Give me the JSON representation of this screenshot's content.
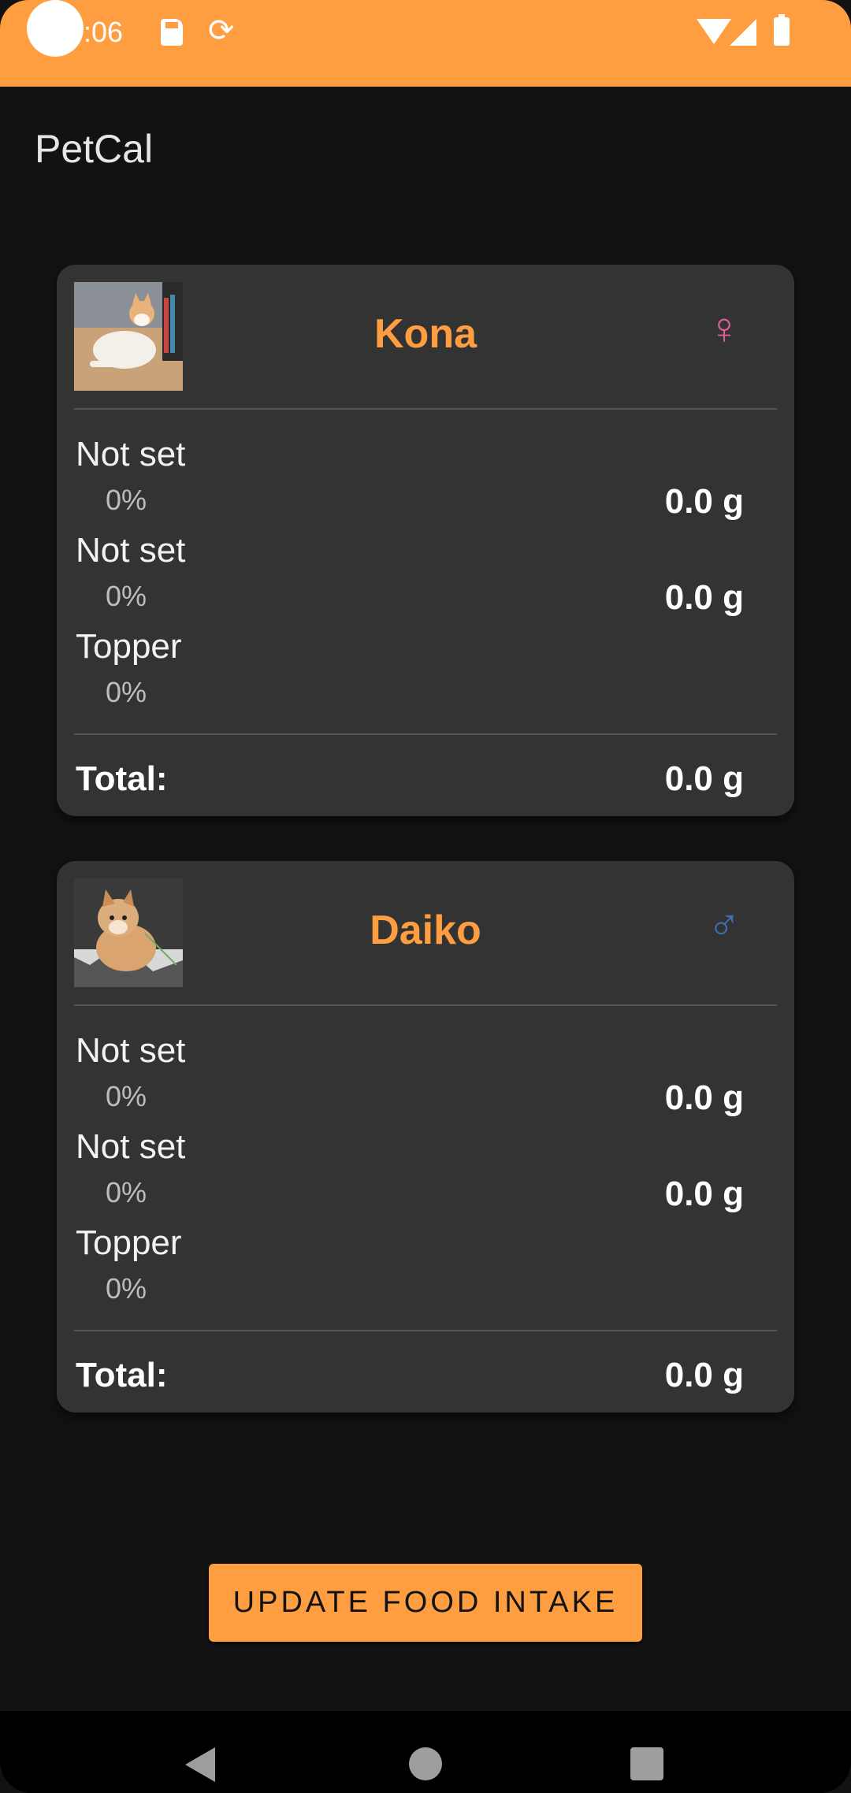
{
  "status_bar": {
    "time": "0:06"
  },
  "app": {
    "title": "PetCal"
  },
  "pets": [
    {
      "name": "Kona",
      "gender_icon": "♀",
      "gender": "female",
      "foods": [
        {
          "label": "Not set",
          "percent": "0%",
          "amount": "0.0 g"
        },
        {
          "label": "Not set",
          "percent": "0%",
          "amount": "0.0 g"
        },
        {
          "label": "Topper",
          "percent": "0%"
        }
      ],
      "total_label": "Total:",
      "total_amount": "0.0 g"
    },
    {
      "name": "Daiko",
      "gender_icon": "♂",
      "gender": "male",
      "foods": [
        {
          "label": "Not set",
          "percent": "0%",
          "amount": "0.0 g"
        },
        {
          "label": "Not set",
          "percent": "0%",
          "amount": "0.0 g"
        },
        {
          "label": "Topper",
          "percent": "0%"
        }
      ],
      "total_label": "Total:",
      "total_amount": "0.0 g"
    }
  ],
  "actions": {
    "update_label": "UPDATE FOOD INTAKE"
  },
  "icons": {
    "sd_card": "sd-card-icon",
    "sync": "sync-icon",
    "wifi": "wifi-icon",
    "signal": "signal-icon",
    "battery": "battery-icon",
    "back": "nav-back-icon",
    "home": "nav-home-icon",
    "recent": "nav-recent-icon"
  },
  "colors": {
    "accent": "#ff9e40",
    "background": "#121212",
    "card": "#333333",
    "female": "#e05c9a",
    "male": "#3f6eb5"
  }
}
